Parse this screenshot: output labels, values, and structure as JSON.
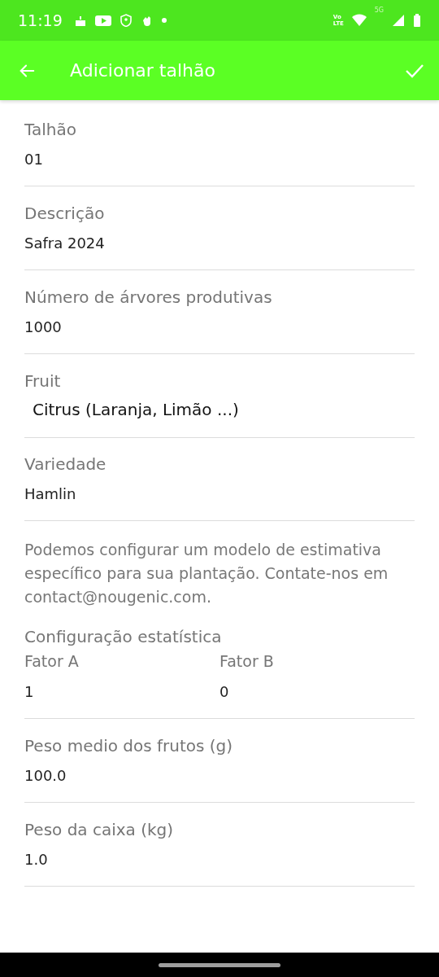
{
  "status_bar": {
    "time": "11:19",
    "volte_top": "Vo",
    "volte_bottom": "LTE",
    "network": "5G"
  },
  "app_bar": {
    "title": "Adicionar talhão"
  },
  "fields": [
    {
      "kind": "text",
      "label": "Talhão",
      "value": "01"
    },
    {
      "kind": "text",
      "label": "Descrição",
      "value": "Safra 2024"
    },
    {
      "kind": "text",
      "label": "Número de árvores produtivas",
      "value": "1000"
    },
    {
      "kind": "select",
      "label": "Fruit",
      "value": "Citrus (Laranja, Limão ...)"
    },
    {
      "kind": "text",
      "label": "Variedade",
      "value": "Hamlin"
    },
    {
      "kind": "note",
      "text": "Podemos configurar um modelo de estimativa específico para sua plantação. Contate-nos em contact@nougenic.com."
    },
    {
      "kind": "pair",
      "label": "Configuração estatística",
      "items": [
        {
          "label": "Fator A",
          "value": "1"
        },
        {
          "label": "Fator B",
          "value": "0"
        }
      ]
    },
    {
      "kind": "text",
      "label": "Peso medio dos frutos (g)",
      "value": "100.0"
    },
    {
      "kind": "text",
      "label": "Peso da caixa (kg)",
      "value": "1.0"
    }
  ]
}
